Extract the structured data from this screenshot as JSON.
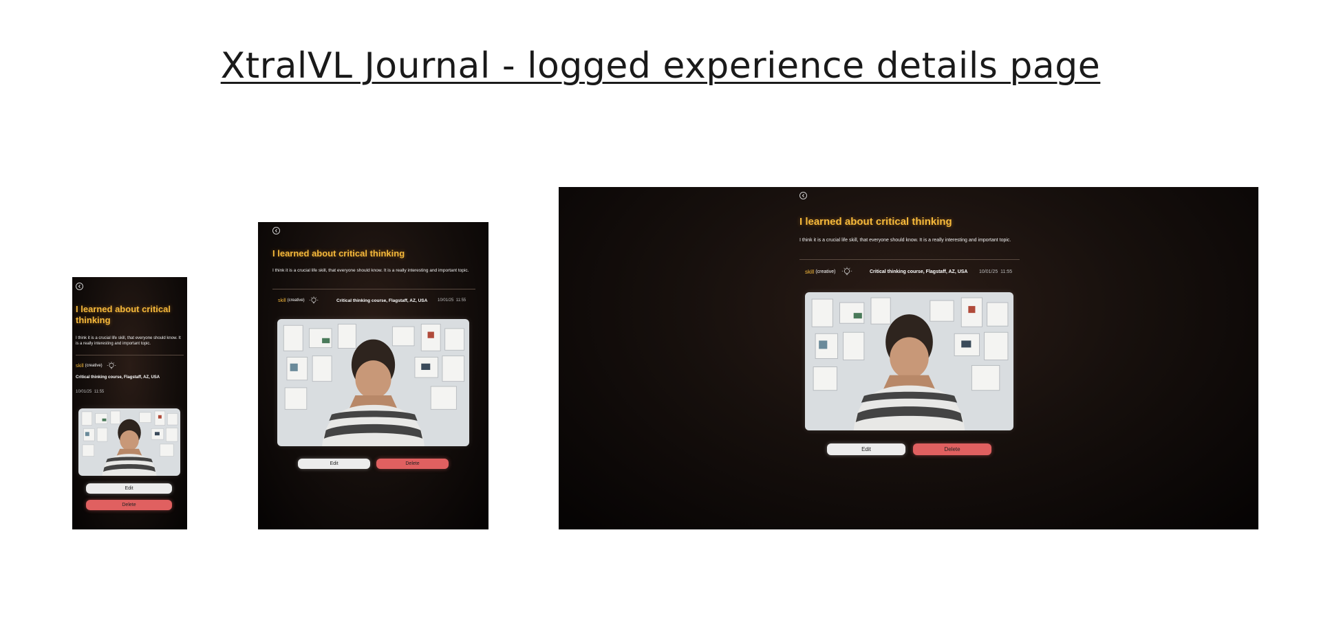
{
  "page": {
    "title": "XtralVL Journal - logged experience details page"
  },
  "entry": {
    "title": "I learned about critical thinking",
    "description": "I think it is a crucial life skill, that everyone should know. It is a really interesting and important topic.",
    "category": "skill",
    "subcategory": "(creative)",
    "category_icon": "lightbulb-icon",
    "location": "Critical thinking course, Flagstaff, AZ, USA",
    "date": "10/01/25",
    "time": "11:55",
    "photo_icon": "man-looking-at-moodboard-photo"
  },
  "actions": {
    "edit_label": "Edit",
    "delete_label": "Delete"
  },
  "colors": {
    "accent": "#f5b93b",
    "delete": "#e06060",
    "edit": "#ececec",
    "background": "#0f0a08"
  }
}
